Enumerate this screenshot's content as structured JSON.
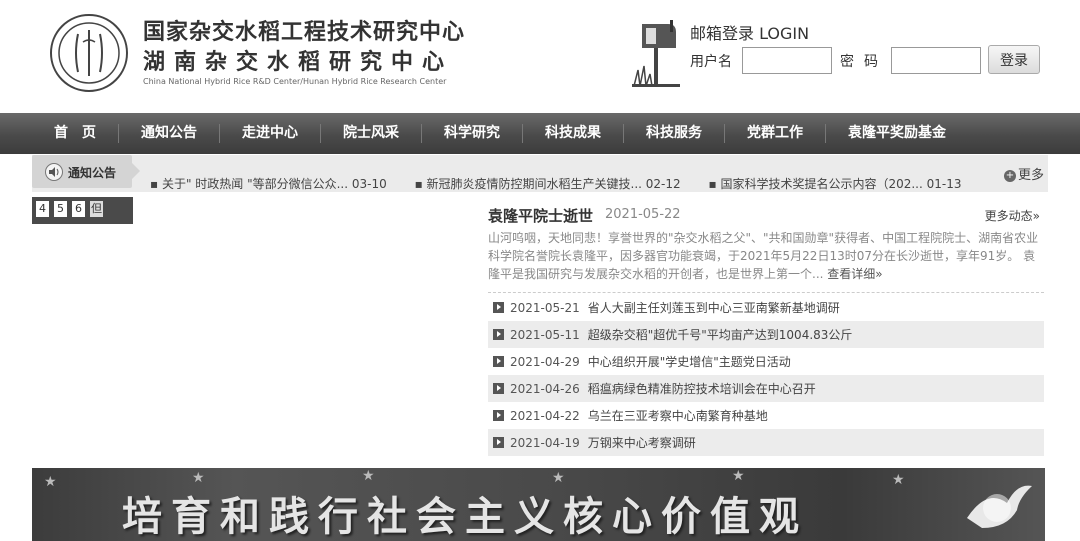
{
  "header": {
    "logo_text_top": "HHRRC",
    "logo_text_bottom": "CNHHRDC",
    "title_line1": "国家杂交水稻工程技术研究中心",
    "title_line2": "湖南杂交水稻研究中心",
    "title_en": "China National Hybrid Rice R&D Center/Hunan Hybrid Rice Research Center"
  },
  "login": {
    "title": "邮箱登录 LOGIN",
    "username_label": "用户名",
    "username_value": "",
    "password_label": "密码",
    "password_value": "",
    "submit_label": "登录"
  },
  "nav": {
    "items": [
      {
        "label": "首　页"
      },
      {
        "label": "通知公告"
      },
      {
        "label": "走进中心"
      },
      {
        "label": "院士风采"
      },
      {
        "label": "科学研究"
      },
      {
        "label": "科技成果"
      },
      {
        "label": "科技服务"
      },
      {
        "label": "党群工作"
      },
      {
        "label": "袁隆平奖励基金"
      }
    ]
  },
  "notice": {
    "label": "通知公告",
    "items": [
      {
        "text": "关于\" 时政热闻 \"等部分微信公众... 03-10"
      },
      {
        "text": "新冠肺炎疫情防控期间水稻生产关键技... 02-12"
      },
      {
        "text": "国家科学技术奖提名公示内容（202... 01-13"
      }
    ],
    "more_label": "更多"
  },
  "slider": {
    "pages": [
      "4",
      "5",
      "6",
      "但"
    ]
  },
  "news": {
    "lead_title": "袁隆平院士逝世",
    "lead_date": "2021-05-22",
    "more_label": "更多动态»",
    "lead_summary": "山河呜咽，天地同悲！享誉世界的\"杂交水稻之父\"、\"共和国勋章\"获得者、中国工程院院士、湖南省农业科学院名誉院长袁隆平，因多器官功能衰竭，于2021年5月22日13时07分在长沙逝世，享年91岁。 袁隆平是我国研究与发展杂交水稻的开创者，也是世界上第一个...",
    "lead_link": "查看详细»",
    "items": [
      {
        "date": "2021-05-21",
        "title": "省人大副主任刘莲玉到中心三亚南繁新基地调研"
      },
      {
        "date": "2021-05-11",
        "title": "超级杂交稻\"超优千号\"平均亩产达到1004.83公斤"
      },
      {
        "date": "2021-04-29",
        "title": "中心组织开展\"学史增信\"主题党日活动"
      },
      {
        "date": "2021-04-26",
        "title": "稻瘟病绿色精准防控技术培训会在中心召开"
      },
      {
        "date": "2021-04-22",
        "title": "乌兰在三亚考察中心南繁育种基地"
      },
      {
        "date": "2021-04-19",
        "title": "万钢来中心考察调研"
      }
    ]
  },
  "banner": {
    "text": "培育和践行社会主义核心价值观"
  }
}
